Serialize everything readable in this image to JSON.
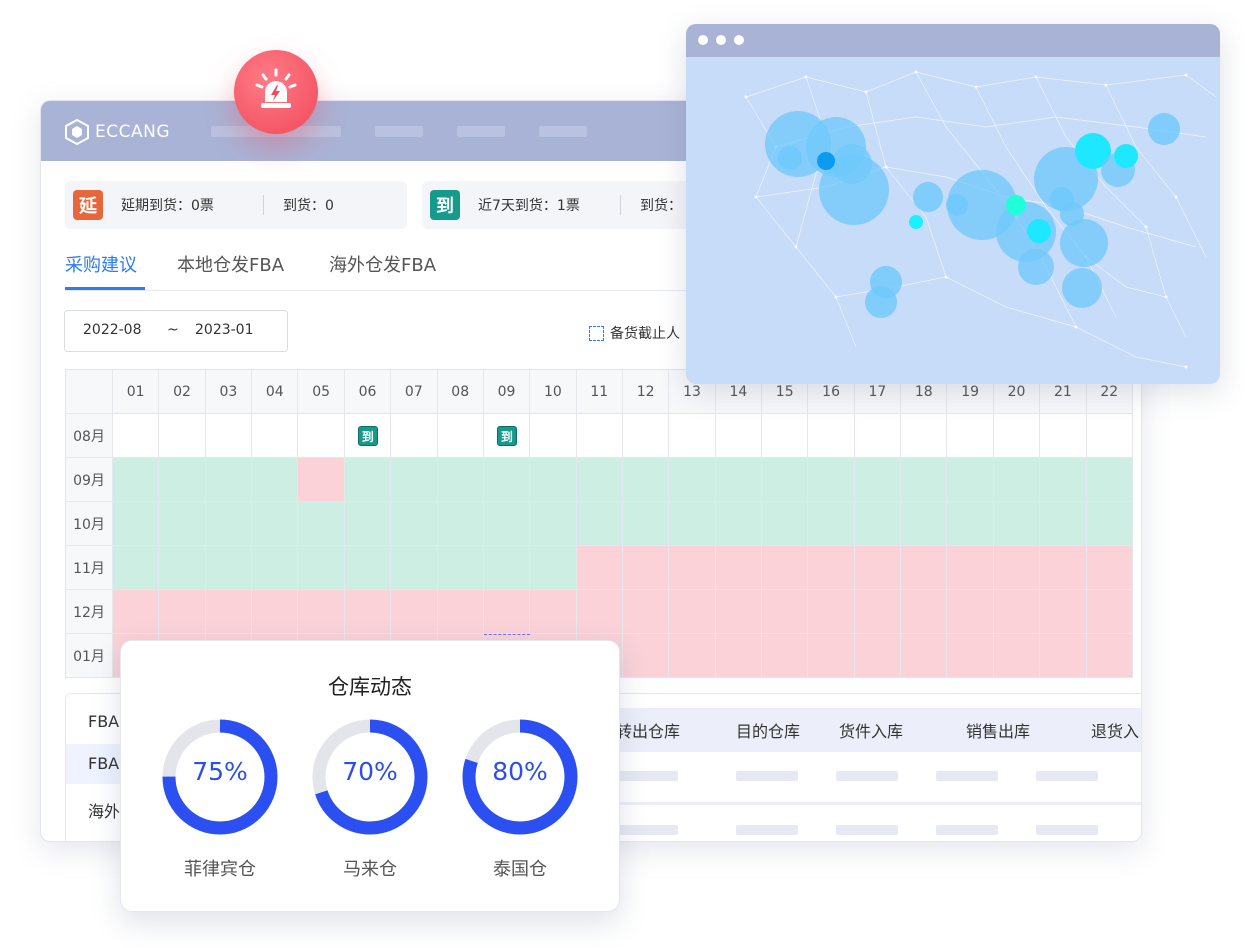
{
  "header": {
    "brand": "ECCANG"
  },
  "status": {
    "delayed_badge": "延",
    "delayed_label": "延期到货：0票",
    "delayed_arrived": "到货：0",
    "recent_badge": "到",
    "recent_label": "近7天到货：1票",
    "recent_arrived": "到货："
  },
  "tabs": [
    "采购建议",
    "本地仓发FBA",
    "海外仓发FBA"
  ],
  "date_range": {
    "start": "2022-08",
    "sep": "~",
    "end": "2023-01"
  },
  "legend": {
    "label": "备货截止人"
  },
  "calendar": {
    "days": [
      "01",
      "02",
      "03",
      "04",
      "05",
      "06",
      "07",
      "08",
      "09",
      "10",
      "11",
      "12",
      "13",
      "14",
      "15",
      "16",
      "17",
      "18",
      "19",
      "20",
      "21",
      "22"
    ],
    "months": [
      "08月",
      "09月",
      "10月",
      "11月",
      "12月",
      "01月"
    ],
    "arrival_mark": "到",
    "colors": {
      "green": "#cdeee2",
      "red": "#fad2d8",
      "badge": "#159a8c"
    }
  },
  "table": {
    "side_rows": [
      "FBA",
      "FBA",
      "海外"
    ],
    "headers": [
      "转出仓库",
      "目的仓库",
      "货件入库",
      "销售出库",
      "退货入"
    ]
  },
  "warehouse": {
    "title": "仓库动态",
    "items": [
      {
        "name": "菲律宾仓",
        "percent_label": "75%",
        "value": 0.75
      },
      {
        "name": "马来仓",
        "percent_label": "70%",
        "value": 0.7
      },
      {
        "name": "泰国仓",
        "percent_label": "80%",
        "value": 0.8
      }
    ],
    "ring_color": "#2b4ff0",
    "track_color": "#e4e5ea"
  },
  "colors": {
    "accent": "#2d7cf5",
    "header": "#a9b3d6",
    "alert": "#f04a5b"
  }
}
